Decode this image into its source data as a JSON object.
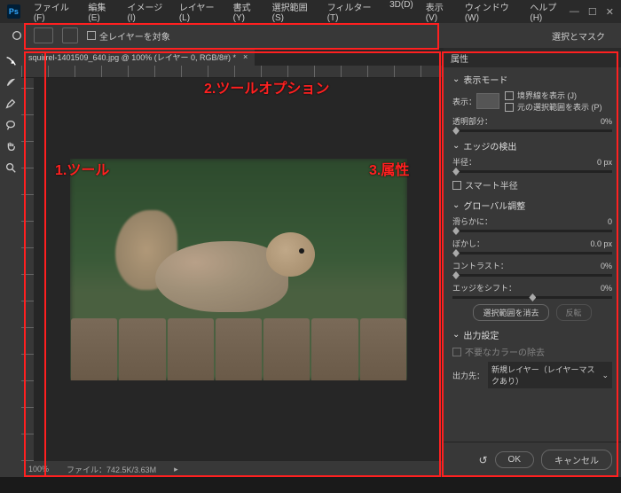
{
  "menu": {
    "file": "ファイル(F)",
    "edit": "編集(E)",
    "image": "イメージ(I)",
    "layer": "レイヤー(L)",
    "type": "書式(Y)",
    "select": "選択範囲(S)",
    "filter": "フィルター(T)",
    "3d": "3D(D)",
    "view": "表示(V)",
    "window": "ウィンドウ(W)",
    "help": "ヘルプ(H)"
  },
  "opt": {
    "sample_all": "全レイヤーを対象",
    "select_mask": "選択とマスク"
  },
  "doc": {
    "title": "squirrel-1401509_640.jpg @ 100% (レイヤー 0, RGB/8#) *"
  },
  "status": {
    "zoom": "100%",
    "info": "ファイル：742.5K/3.63M"
  },
  "panel": {
    "title": "属性",
    "view_mode": "表示モード",
    "show": "表示：",
    "show_edge": "境界線を表示 (J)",
    "show_orig": "元の選択範囲を表示 (P)",
    "transparency": "透明部分：",
    "edge_detect": "エッジの検出",
    "radius": "半径：",
    "radius_val": "0 px",
    "smart_radius": "スマート半径",
    "global": "グローバル調整",
    "smooth": "滑らかに：",
    "smooth_val": "0",
    "feather": "ぼかし：",
    "feather_val": "0.0 px",
    "contrast": "コントラスト：",
    "contrast_val": "0%",
    "shift": "エッジをシフト：",
    "shift_val": "0%",
    "trans_val": "0%",
    "clear": "選択範囲を消去",
    "invert": "反転",
    "output": "出力設定",
    "unnecessary": "不要なカラーの除去",
    "output_to": "出力先：",
    "output_sel": "新規レイヤー（レイヤーマスクあり）",
    "ok": "OK",
    "cancel": "キャンセル"
  },
  "anno": {
    "tools": "1.ツール",
    "options": "2.ツールオプション",
    "props": "3.属性"
  }
}
